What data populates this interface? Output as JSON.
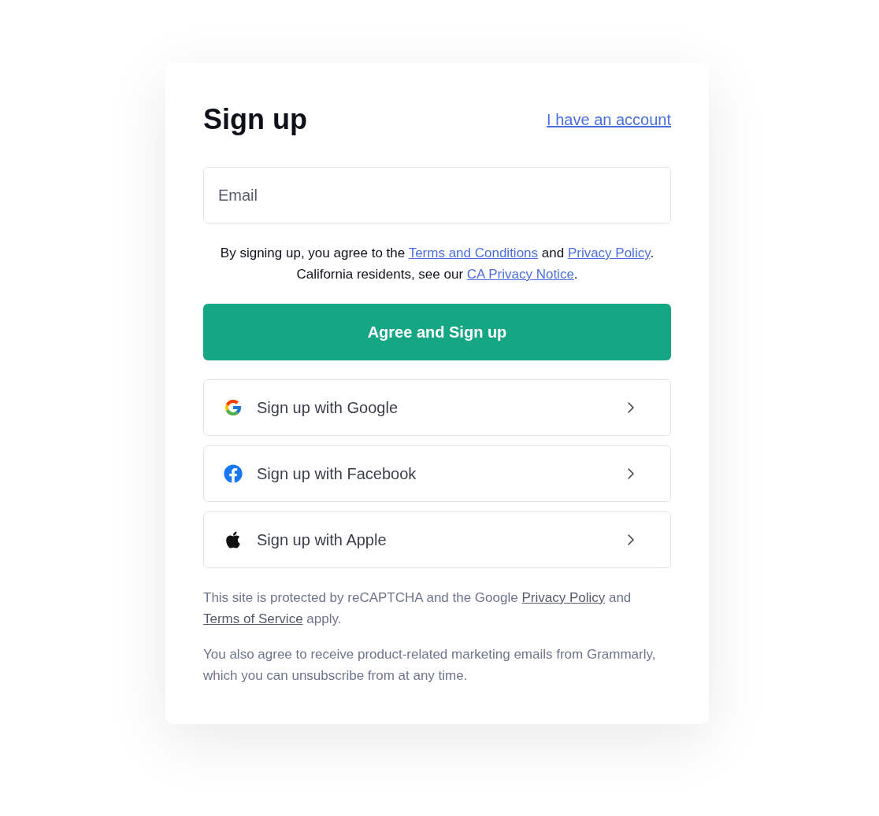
{
  "title": "Sign up",
  "account_link": "I have an account",
  "email_field": {
    "placeholder": "Email"
  },
  "terms": [
    {
      "kind": "text",
      "text": "By signing up, you agree to the "
    },
    {
      "kind": "link",
      "text": "Terms and Conditions"
    },
    {
      "kind": "text",
      "text": " and "
    },
    {
      "kind": "link",
      "text": "Privacy Policy"
    },
    {
      "kind": "text",
      "text": ". California residents, see our "
    },
    {
      "kind": "link",
      "text": "CA Privacy Notice"
    },
    {
      "kind": "text",
      "text": "."
    }
  ],
  "primary_button": "Agree and Sign up",
  "social_buttons": [
    {
      "kind": "google",
      "label": "Sign up with Google"
    },
    {
      "kind": "facebook",
      "label": "Sign up with Facebook"
    },
    {
      "kind": "apple",
      "label": "Sign up with Apple"
    }
  ],
  "recaptcha_note": [
    {
      "kind": "text",
      "text": "This site is protected by reCAPTCHA and the Google "
    },
    {
      "kind": "link",
      "text": "Privacy Policy"
    },
    {
      "kind": "text",
      "text": " and "
    },
    {
      "kind": "link",
      "text": "Terms of Service"
    },
    {
      "kind": "text",
      "text": " apply."
    }
  ],
  "marketing_note": "You also agree to receive product-related marketing emails from Grammarly, which you can unsubscribe from at any time."
}
